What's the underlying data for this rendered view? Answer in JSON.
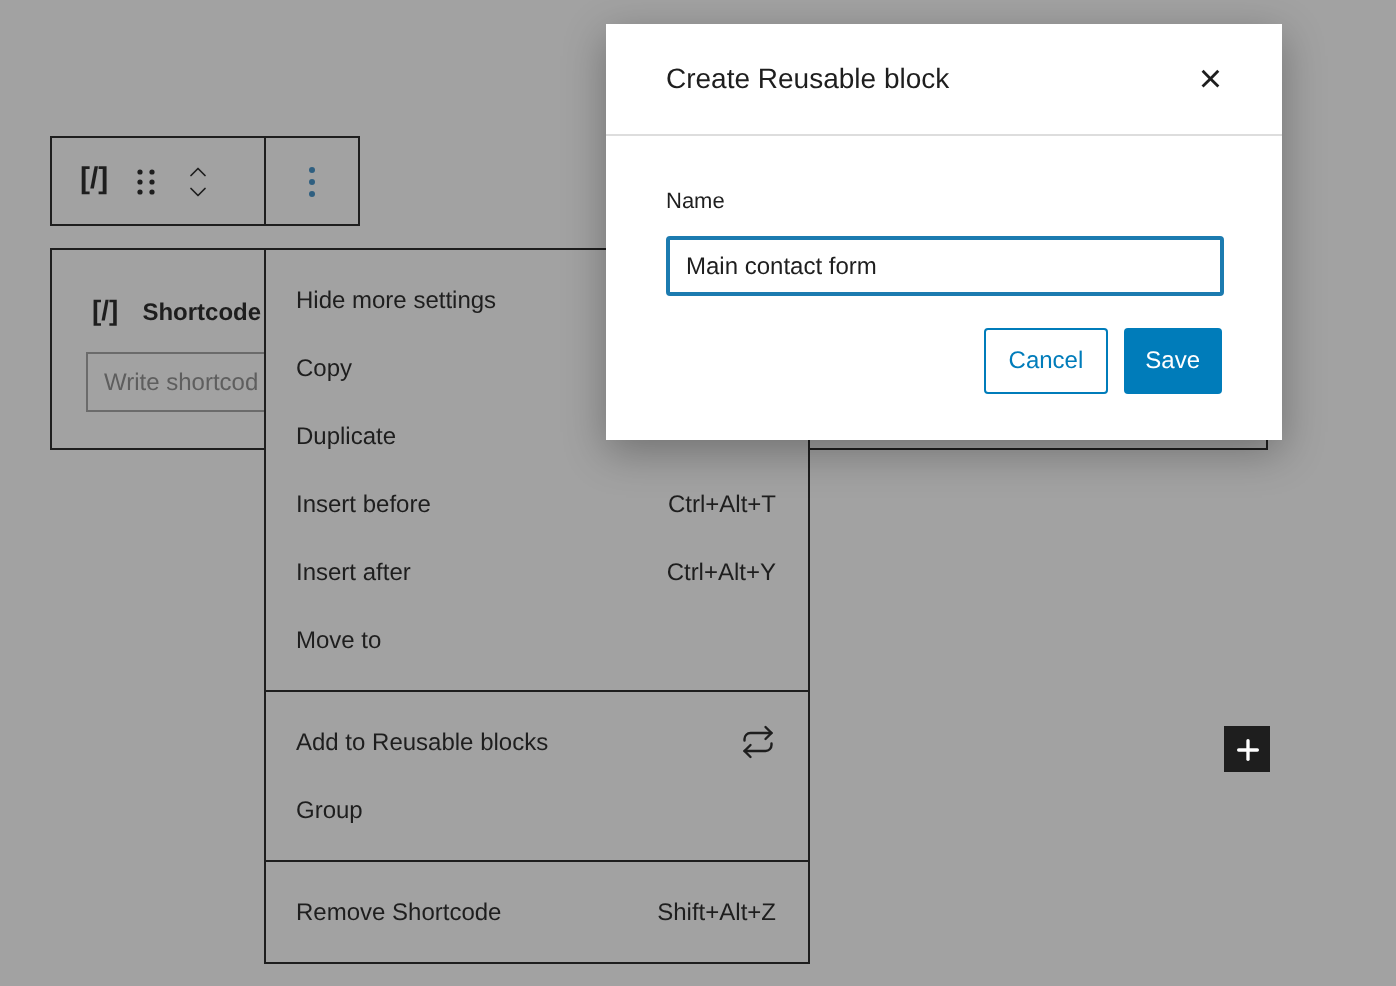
{
  "block_toolbar": {
    "block_icon": "[/]"
  },
  "block": {
    "icon": "[/]",
    "title": "Shortcode",
    "input_placeholder": "Write shortcod"
  },
  "menu": {
    "groups": [
      {
        "items": [
          {
            "label": "Hide more settings"
          },
          {
            "label": "Copy"
          },
          {
            "label": "Duplicate"
          },
          {
            "label": "Insert before",
            "shortcut": "Ctrl+Alt+T"
          },
          {
            "label": "Insert after",
            "shortcut": "Ctrl+Alt+Y"
          },
          {
            "label": "Move to"
          }
        ]
      },
      {
        "items": [
          {
            "label": "Add to Reusable blocks",
            "kind": "icon"
          },
          {
            "label": "Group"
          }
        ]
      },
      {
        "items": [
          {
            "label": "Remove Shortcode",
            "shortcut": "Shift+Alt+Z"
          }
        ]
      }
    ]
  },
  "dialog": {
    "title": "Create Reusable block",
    "close": "×",
    "field_label": "Name",
    "field_value": "Main contact form",
    "buttons": [
      {
        "label": "Cancel",
        "kind": "secondary"
      },
      {
        "label": "Save",
        "kind": "primary"
      }
    ]
  }
}
